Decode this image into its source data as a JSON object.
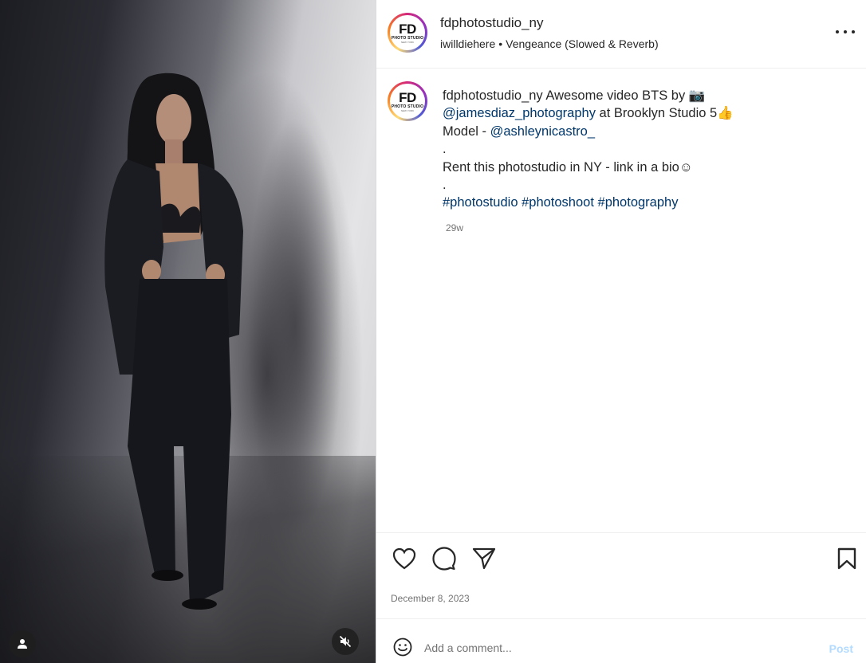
{
  "post": {
    "username": "fdphotostudio_ny",
    "avatar_text": {
      "big": "FD",
      "small": "PHOTO STUDIO",
      "tiny": "NEW YORK"
    },
    "audio_artist": "iwilldiehere",
    "audio_separator": "•",
    "audio_track": "Vengeance (Slowed & Reverb)",
    "date": "December 8, 2023"
  },
  "caption": {
    "username": "fdphotostudio_ny",
    "line1_text": " Awesome video BTS by 📷",
    "mention_photographer": "@jamesdiaz_photography",
    "line2_text": " at Brooklyn Studio 5👍",
    "model_label": "Model - ",
    "mention_model": "@ashleynicastro_",
    "dot1": ".",
    "rent_text": "Rent this photostudio in NY - link in a bio☺",
    "dot2": ".",
    "hashtags": [
      "#photostudio",
      "#photoshoot",
      "#photography"
    ],
    "time_ago": "29w"
  },
  "comment_box": {
    "placeholder": "Add a comment...",
    "post_label": "Post"
  },
  "icons": {
    "more": "more-options-icon",
    "like": "heart-icon",
    "comment": "comment-bubble-icon",
    "share": "paper-plane-icon",
    "save": "bookmark-icon",
    "emoji": "smiley-icon",
    "user_tag": "user-tag-icon",
    "mute": "muted-speaker-icon"
  },
  "colors": {
    "link": "#00376b",
    "muted_text": "#737373",
    "post_button_disabled": "#b3dbff"
  }
}
